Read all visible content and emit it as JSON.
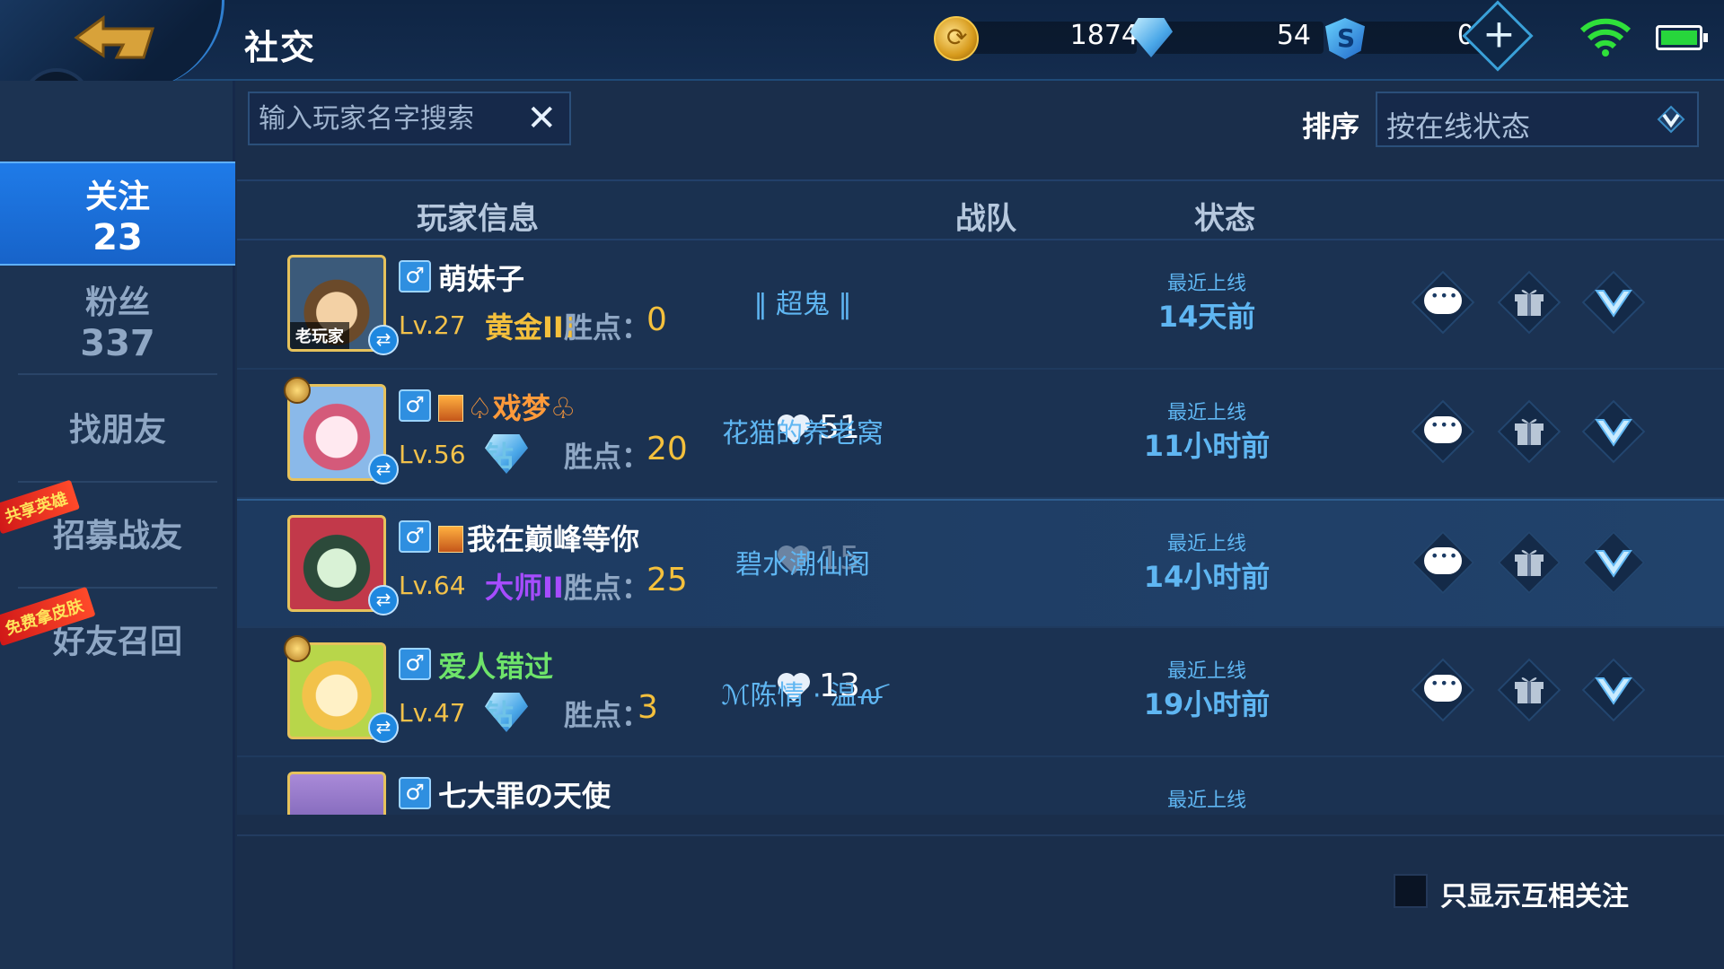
{
  "header": {
    "title": "社交",
    "gold": "1874",
    "diamonds": "54",
    "vouchers": "0"
  },
  "sidebar": {
    "items": [
      {
        "label": "关注",
        "count": "23"
      },
      {
        "label": "粉丝",
        "count": "337"
      },
      {
        "label": "找朋友"
      },
      {
        "label": "招募战友",
        "ribbon": "共享英雄"
      },
      {
        "label": "好友召回",
        "ribbon": "免费拿皮肤"
      }
    ]
  },
  "search": {
    "placeholder": "输入玩家名字搜索"
  },
  "sort": {
    "label": "排序",
    "value": "按在线状态"
  },
  "table": {
    "headers": {
      "player": "玩家信息",
      "team": "战队",
      "status": "状态"
    },
    "rows": [
      {
        "name": "萌妹子",
        "badge": "老玩家",
        "level": "Lv.27",
        "tier": "黄金III",
        "wins_label": "胜点：",
        "wins": "0",
        "intimacy": "",
        "team": "‖ 超鬼 ‖",
        "status_title": "最近上线",
        "status_time": "14天前"
      },
      {
        "name": "♤戏梦♧",
        "level": "Lv.56",
        "tier": "钻石III",
        "wins_label": "胜点：",
        "wins": "20",
        "intimacy": "51",
        "team": "花猫的养老窝",
        "status_title": "最近上线",
        "status_time": "11小时前"
      },
      {
        "name": "我在巅峰等你",
        "level": "Lv.64",
        "tier": "大师II",
        "wins_label": "胜点：",
        "wins": "25",
        "intimacy": "15",
        "team": "碧水潮仙阁",
        "status_title": "最近上线",
        "status_time": "14小时前"
      },
      {
        "name": "爱人错过",
        "level": "Lv.47",
        "tier": "钻石II",
        "wins_label": "胜点：",
        "wins": "3",
        "intimacy": "13",
        "team": "ℳ陈情 · 温ꫛ",
        "status_title": "最近上线",
        "status_time": "19小时前"
      },
      {
        "name": "七大罪の天使",
        "status_title": "最近上线"
      }
    ]
  },
  "footer": {
    "mutual_only_label": "只显示互相关注"
  },
  "colors": {
    "accent": "#1f7be8",
    "gold": "#f4c03c",
    "link": "#5fb6f2"
  }
}
